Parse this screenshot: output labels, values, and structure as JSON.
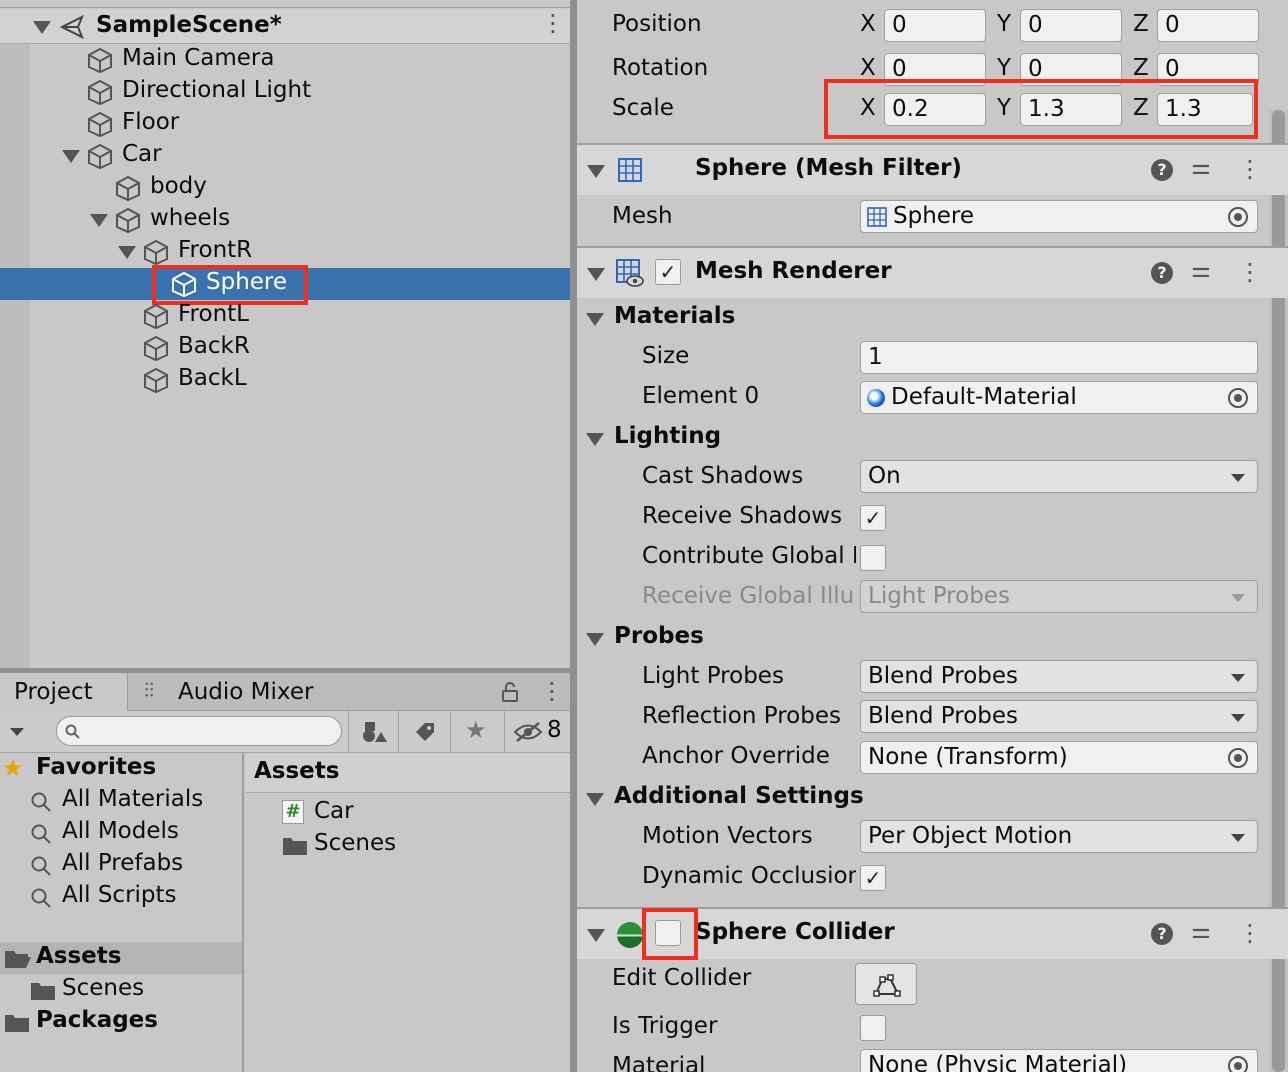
{
  "hierarchy": {
    "scene_name": "SampleScene*",
    "items": [
      {
        "label": "Main Camera"
      },
      {
        "label": "Directional Light"
      },
      {
        "label": "Floor"
      },
      {
        "label": "Car"
      },
      {
        "label": "body"
      },
      {
        "label": "wheels"
      },
      {
        "label": "FrontR"
      },
      {
        "label": "Sphere"
      },
      {
        "label": "FrontL"
      },
      {
        "label": "BackR"
      },
      {
        "label": "BackL"
      }
    ],
    "selected": "Sphere"
  },
  "project_panel": {
    "tabs": [
      {
        "label": "Project"
      },
      {
        "label": "Audio Mixer"
      }
    ],
    "hidden_count": "8",
    "favorites": {
      "label": "Favorites",
      "items": [
        {
          "label": "All Materials"
        },
        {
          "label": "All Models"
        },
        {
          "label": "All Prefabs"
        },
        {
          "label": "All Scripts"
        }
      ]
    },
    "tree": [
      {
        "label": "Assets"
      },
      {
        "label": "Scenes"
      },
      {
        "label": "Packages"
      }
    ],
    "assets_header": "Assets",
    "assets": [
      {
        "label": "Car",
        "icon": "script-icon"
      },
      {
        "label": "Scenes",
        "icon": "folder-icon"
      }
    ]
  },
  "inspector": {
    "transform": {
      "position": {
        "label": "Position",
        "x": "0",
        "y": "0",
        "z": "0"
      },
      "rotation": {
        "label": "Rotation",
        "x": "0",
        "y": "0",
        "z": "0"
      },
      "scale": {
        "label": "Scale",
        "x": "0.2",
        "y": "1.3",
        "z": "1.3"
      },
      "axis": {
        "x": "X",
        "y": "Y",
        "z": "Z"
      }
    },
    "mesh_filter": {
      "title": "Sphere (Mesh Filter)",
      "mesh_label": "Mesh",
      "mesh_value": "Sphere"
    },
    "mesh_renderer": {
      "title": "Mesh Renderer",
      "enabled": true,
      "materials_label": "Materials",
      "size_label": "Size",
      "size_value": "1",
      "element_label": "Element 0",
      "element_value": "Default-Material",
      "lighting_label": "Lighting",
      "cast_shadows_label": "Cast Shadows",
      "cast_shadows_value": "On",
      "receive_shadows_label": "Receive Shadows",
      "receive_shadows": true,
      "contribute_gi_label": "Contribute Global Il",
      "contribute_gi": false,
      "receive_gi_label": "Receive Global Illur",
      "receive_gi_value": "Light Probes",
      "probes_label": "Probes",
      "light_probes_label": "Light Probes",
      "light_probes_value": "Blend Probes",
      "reflection_probes_label": "Reflection Probes",
      "reflection_probes_value": "Blend Probes",
      "anchor_override_label": "Anchor Override",
      "anchor_override_value": "None (Transform)",
      "additional_label": "Additional Settings",
      "motion_vectors_label": "Motion Vectors",
      "motion_vectors_value": "Per Object Motion",
      "dynamic_occlusion_label": "Dynamic Occlusion",
      "dynamic_occlusion": true
    },
    "sphere_collider": {
      "title": "Sphere Collider",
      "enabled": false,
      "edit_collider_label": "Edit Collider",
      "is_trigger_label": "Is Trigger",
      "is_trigger": false,
      "material_label": "Material",
      "material_value": "None (Physic Material)"
    }
  },
  "colors": {
    "selection": "#3a72b0",
    "highlight": "#f02e1d",
    "panel": "#c8c8c8",
    "header": "#d7d7d7"
  }
}
